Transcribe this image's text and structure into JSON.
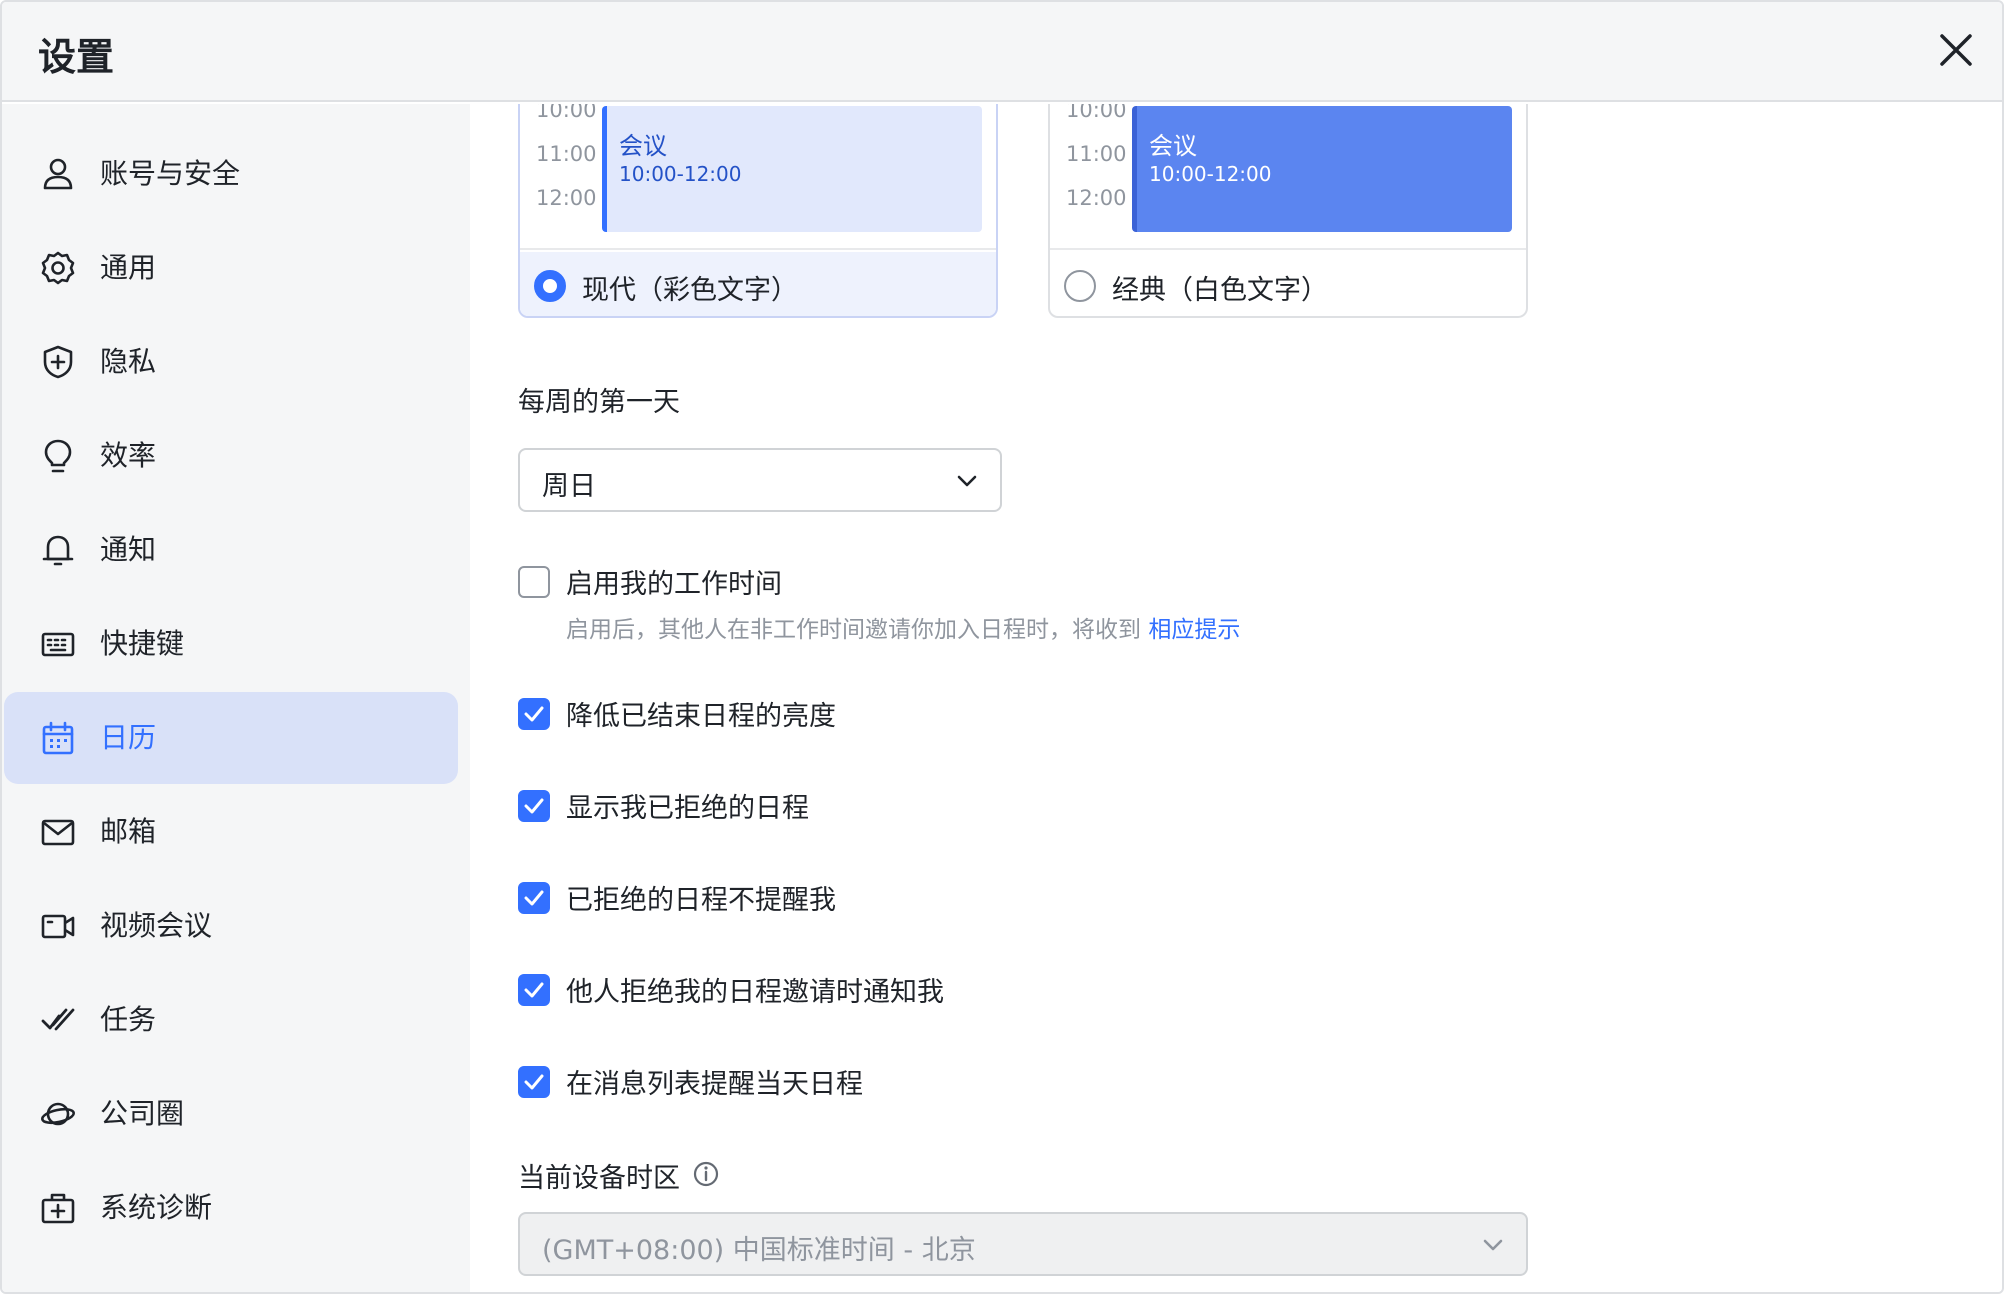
{
  "window": {
    "title": "设置"
  },
  "sidebar": {
    "items": [
      {
        "label": "账号与安全",
        "icon": "user-icon",
        "active": false
      },
      {
        "label": "通用",
        "icon": "gear-icon",
        "active": false
      },
      {
        "label": "隐私",
        "icon": "shield-plus-icon",
        "active": false
      },
      {
        "label": "效率",
        "icon": "lightbulb-icon",
        "active": false
      },
      {
        "label": "通知",
        "icon": "bell-icon",
        "active": false
      },
      {
        "label": "快捷键",
        "icon": "keyboard-icon",
        "active": false
      },
      {
        "label": "日历",
        "icon": "calendar-icon",
        "active": true
      },
      {
        "label": "邮箱",
        "icon": "mail-icon",
        "active": false
      },
      {
        "label": "视频会议",
        "icon": "video-icon",
        "active": false
      },
      {
        "label": "任务",
        "icon": "task-check-icon",
        "active": false
      },
      {
        "label": "公司圈",
        "icon": "planet-icon",
        "active": false
      },
      {
        "label": "系统诊断",
        "icon": "medkit-icon",
        "active": false
      }
    ]
  },
  "theme": {
    "times": [
      "10:00",
      "11:00",
      "12:00"
    ],
    "event_title": "会议",
    "event_time": "10:00-12:00",
    "options": [
      {
        "label": "现代（彩色文字）",
        "selected": true
      },
      {
        "label": "经典（白色文字）",
        "selected": false
      }
    ]
  },
  "week_start": {
    "label": "每周的第一天",
    "value": "周日"
  },
  "work_time": {
    "label": "启用我的工作时间",
    "checked": false,
    "helper": "启用后，其他人在非工作时间邀请你加入日程时，将收到",
    "helper_link": "相应提示"
  },
  "options": [
    {
      "label": "降低已结束日程的亮度",
      "checked": true
    },
    {
      "label": "显示我已拒绝的日程",
      "checked": true
    },
    {
      "label": "已拒绝的日程不提醒我",
      "checked": true
    },
    {
      "label": "他人拒绝我的日程邀请时通知我",
      "checked": true
    },
    {
      "label": "在消息列表提醒当天日程",
      "checked": true
    }
  ],
  "timezone": {
    "label": "当前设备时区",
    "value": "(GMT+08:00) 中国标准时间 - 北京"
  },
  "colors": {
    "accent": "#3370ff",
    "sidebar_active_bg": "#d9e1f8",
    "classic_event": "#5b85f0"
  }
}
